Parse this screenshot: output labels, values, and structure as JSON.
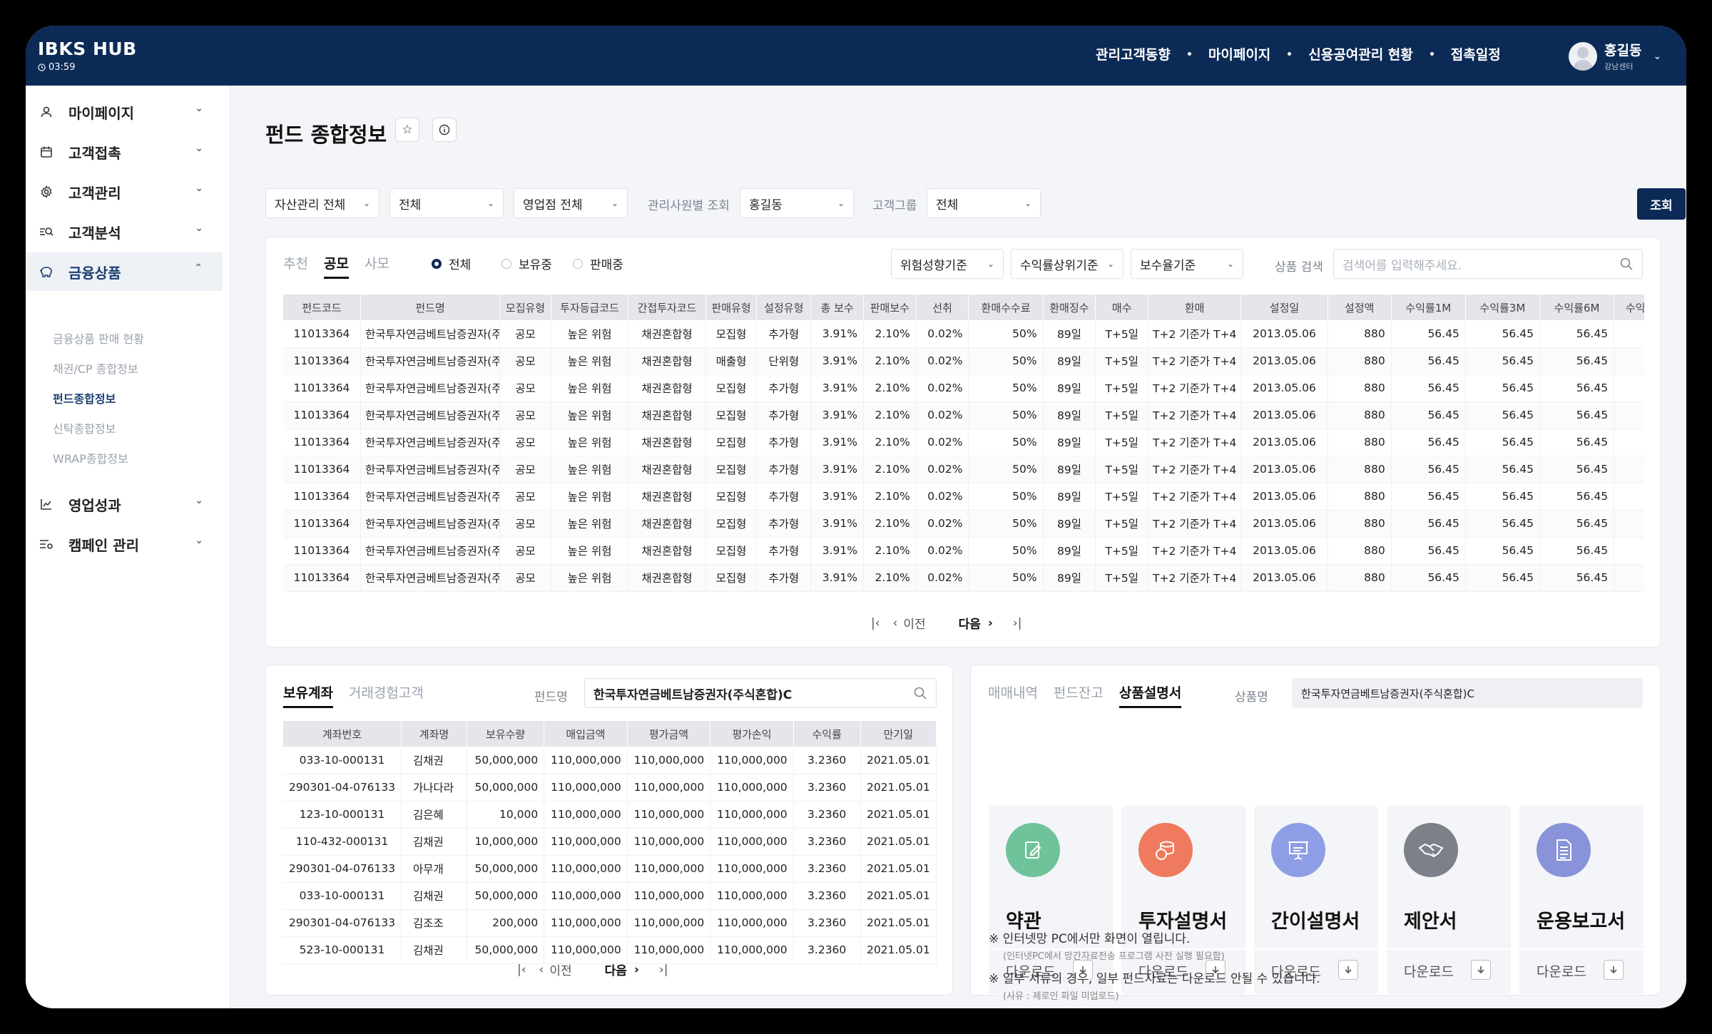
{
  "app": {
    "title": "IBKS HUB",
    "timer": "03:59"
  },
  "topnav": [
    "관리고객동향",
    "마이페이지",
    "신용공여관리 현황",
    "접촉일정"
  ],
  "user": {
    "name": "홍길동",
    "branch": "강남센터"
  },
  "sidebar": {
    "items": [
      {
        "label": "마이페이지",
        "icon": "user-icon"
      },
      {
        "label": "고객접촉",
        "icon": "calendar-icon"
      },
      {
        "label": "고객관리",
        "icon": "gear-icon"
      },
      {
        "label": "고객분석",
        "icon": "analysis-icon"
      },
      {
        "label": "금융상품",
        "icon": "piggy-bank-icon"
      },
      {
        "label": "영업성과",
        "icon": "line-chart-icon"
      },
      {
        "label": "캠페인 관리",
        "icon": "campaign-icon"
      }
    ],
    "subitems": [
      "금융상품 판매 현황",
      "채권/CP 종합정보",
      "펀드종합정보",
      "신탁종합정보",
      "WRAP종합정보"
    ],
    "active_subitem": "펀드종합정보"
  },
  "page": {
    "title": "펀드 종합정보"
  },
  "filters": {
    "asset": "자산관리 전체",
    "all": "전체",
    "branch": "영업점 전체",
    "manager_label": "관리사원별 조회",
    "manager": "홍길동",
    "group_label": "고객그룹",
    "group": "전체",
    "query_button": "조회"
  },
  "fund_panel": {
    "tabs": [
      "추천",
      "공모",
      "사모"
    ],
    "active_tab": "공모",
    "radios": [
      "전체",
      "보유중",
      "판매중"
    ],
    "selected_radio": "전체",
    "sort1": "위험성향기준",
    "sort2": "수익률상위기준",
    "sort3": "보수율기준",
    "search_label": "상품 검색",
    "search_placeholder": "검색어를 입력해주세요.",
    "columns": [
      "펀드코드",
      "펀드명",
      "모집유형",
      "투자등급코드",
      "간접투자코드",
      "판매유형",
      "설정유형",
      "총 보수",
      "판매보수",
      "선취",
      "환매수수료",
      "환매징수",
      "매수",
      "환매",
      "설정일",
      "설정액",
      "수익률1M",
      "수익률3M",
      "수익률6M",
      "수익률"
    ],
    "rows": [
      [
        "11013364",
        "한국투자연금베트남증권자(주",
        "공모",
        "높은 위험",
        "채권혼합형",
        "모집형",
        "추가형",
        "3.91%",
        "2.10%",
        "0.02%",
        "50%",
        "89일",
        "T+5일",
        "T+2 기준가 T+4",
        "2013.05.06",
        "880",
        "56.45",
        "56.45",
        "56.45",
        ""
      ],
      [
        "11013364",
        "한국투자연금베트남증권자(주",
        "공모",
        "높은 위험",
        "채권혼합형",
        "매출형",
        "단위형",
        "3.91%",
        "2.10%",
        "0.02%",
        "50%",
        "89일",
        "T+5일",
        "T+2 기준가 T+4",
        "2013.05.06",
        "880",
        "56.45",
        "56.45",
        "56.45",
        ""
      ],
      [
        "11013364",
        "한국투자연금베트남증권자(주",
        "공모",
        "높은 위험",
        "채권혼합형",
        "모집형",
        "추가형",
        "3.91%",
        "2.10%",
        "0.02%",
        "50%",
        "89일",
        "T+5일",
        "T+2 기준가 T+4",
        "2013.05.06",
        "880",
        "56.45",
        "56.45",
        "56.45",
        ""
      ],
      [
        "11013364",
        "한국투자연금베트남증권자(주",
        "공모",
        "높은 위험",
        "채권혼합형",
        "모집형",
        "추가형",
        "3.91%",
        "2.10%",
        "0.02%",
        "50%",
        "89일",
        "T+5일",
        "T+2 기준가 T+4",
        "2013.05.06",
        "880",
        "56.45",
        "56.45",
        "56.45",
        ""
      ],
      [
        "11013364",
        "한국투자연금베트남증권자(주",
        "공모",
        "높은 위험",
        "채권혼합형",
        "모집형",
        "추가형",
        "3.91%",
        "2.10%",
        "0.02%",
        "50%",
        "89일",
        "T+5일",
        "T+2 기준가 T+4",
        "2013.05.06",
        "880",
        "56.45",
        "56.45",
        "56.45",
        ""
      ],
      [
        "11013364",
        "한국투자연금베트남증권자(주",
        "공모",
        "높은 위험",
        "채권혼합형",
        "모집형",
        "추가형",
        "3.91%",
        "2.10%",
        "0.02%",
        "50%",
        "89일",
        "T+5일",
        "T+2 기준가 T+4",
        "2013.05.06",
        "880",
        "56.45",
        "56.45",
        "56.45",
        ""
      ],
      [
        "11013364",
        "한국투자연금베트남증권자(주",
        "공모",
        "높은 위험",
        "채권혼합형",
        "모집형",
        "추가형",
        "3.91%",
        "2.10%",
        "0.02%",
        "50%",
        "89일",
        "T+5일",
        "T+2 기준가 T+4",
        "2013.05.06",
        "880",
        "56.45",
        "56.45",
        "56.45",
        ""
      ],
      [
        "11013364",
        "한국투자연금베트남증권자(주",
        "공모",
        "높은 위험",
        "채권혼합형",
        "모집형",
        "추가형",
        "3.91%",
        "2.10%",
        "0.02%",
        "50%",
        "89일",
        "T+5일",
        "T+2 기준가 T+4",
        "2013.05.06",
        "880",
        "56.45",
        "56.45",
        "56.45",
        ""
      ],
      [
        "11013364",
        "한국투자연금베트남증권자(주",
        "공모",
        "높은 위험",
        "채권혼합형",
        "모집형",
        "추가형",
        "3.91%",
        "2.10%",
        "0.02%",
        "50%",
        "89일",
        "T+5일",
        "T+2 기준가 T+4",
        "2013.05.06",
        "880",
        "56.45",
        "56.45",
        "56.45",
        ""
      ],
      [
        "11013364",
        "한국투자연금베트남증권자(주",
        "공모",
        "높은 위험",
        "채권혼합형",
        "모집형",
        "추가형",
        "3.91%",
        "2.10%",
        "0.02%",
        "50%",
        "89일",
        "T+5일",
        "T+2 기준가 T+4",
        "2013.05.06",
        "880",
        "56.45",
        "56.45",
        "56.45",
        ""
      ]
    ],
    "pager": {
      "prev": "이전",
      "next": "다음"
    }
  },
  "holding_panel": {
    "tabs": [
      "보유계좌",
      "거래경험고객"
    ],
    "active_tab": "보유계좌",
    "fund_label": "펀드명",
    "fund_value": "한국투자연금베트남증권자(주식혼합)C",
    "columns": [
      "계좌번호",
      "계좌명",
      "보유수량",
      "매입금액",
      "평가금액",
      "평가손익",
      "수익률",
      "만기일"
    ],
    "rows": [
      [
        "033-10-000131",
        "김채권",
        "50,000,000",
        "110,000,000",
        "110,000,000",
        "110,000,000",
        "3.2360",
        "2021.05.01"
      ],
      [
        "290301-04-076133",
        "가나다라",
        "50,000,000",
        "110,000,000",
        "110,000,000",
        "110,000,000",
        "3.2360",
        "2021.05.01"
      ],
      [
        "123-10-000131",
        "김은혜",
        "10,000",
        "110,000,000",
        "110,000,000",
        "110,000,000",
        "3.2360",
        "2021.05.01"
      ],
      [
        "110-432-000131",
        "김채권",
        "10,000,000",
        "110,000,000",
        "110,000,000",
        "110,000,000",
        "3.2360",
        "2021.05.01"
      ],
      [
        "290301-04-076133",
        "아무개",
        "50,000,000",
        "110,000,000",
        "110,000,000",
        "110,000,000",
        "3.2360",
        "2021.05.01"
      ],
      [
        "033-10-000131",
        "김채권",
        "50,000,000",
        "110,000,000",
        "110,000,000",
        "110,000,000",
        "3.2360",
        "2021.05.01"
      ],
      [
        "290301-04-076133",
        "김조조",
        "200,000",
        "110,000,000",
        "110,000,000",
        "110,000,000",
        "3.2360",
        "2021.05.01"
      ],
      [
        "523-10-000131",
        "김채권",
        "50,000,000",
        "110,000,000",
        "110,000,000",
        "110,000,000",
        "3.2360",
        "2021.05.01"
      ]
    ],
    "pager": {
      "prev": "이전",
      "next": "다음"
    }
  },
  "docs_panel": {
    "tabs": [
      "매매내역",
      "펀드잔고",
      "상품설명서"
    ],
    "active_tab": "상품설명서",
    "product_label": "상품명",
    "product_value": "한국투자연금베트남증권자(주식혼합)C",
    "download_label": "다운로드",
    "docs": [
      {
        "title": "약관",
        "icon": "document-edit-icon",
        "color": "#6fc39a"
      },
      {
        "title": "투자설명서",
        "icon": "coins-icon",
        "color": "#f07a5d"
      },
      {
        "title": "간이설명서",
        "icon": "presentation-icon",
        "color": "#8e9ee6"
      },
      {
        "title": "제안서",
        "icon": "handshake-icon",
        "color": "#7d8089"
      },
      {
        "title": "운용보고서",
        "icon": "report-icon",
        "color": "#8893d9"
      }
    ],
    "notes": [
      "※ 인터넷망 PC에서만 화면이 열립니다.",
      "(인터넷PC에서 망간자료전송 프로그램 사전 실행 필요함)",
      "※ 일부 서류의 경우, 일부 펀드자료는 다운로드 안될 수 있습니다.",
      "(사유 : 제로인 파일 미업로드)"
    ]
  }
}
